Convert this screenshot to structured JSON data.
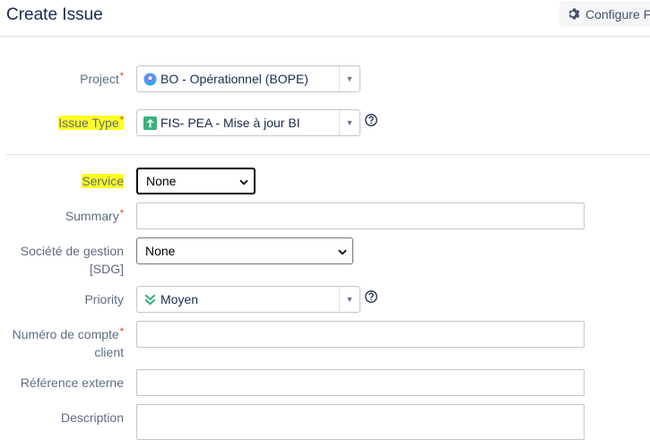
{
  "header": {
    "title": "Create Issue",
    "configure_label": "Configure F",
    "gear_icon": "gear-icon"
  },
  "fields": {
    "project": {
      "label": "Project",
      "required": "*",
      "value": "BO - Opérationnel (BOPE)",
      "icon": "project-avatar-icon"
    },
    "issue_type": {
      "label": "Issue Type",
      "required": "*",
      "value": "FIS- PEA - Mise à jour BI",
      "icon": "arrow-up-icon",
      "highlighted": true
    },
    "service": {
      "label": "Service",
      "value": "None",
      "highlighted": true
    },
    "summary": {
      "label": "Summary",
      "required": "*",
      "value": ""
    },
    "societe": {
      "label_line1": "Société de gestion",
      "label_line2": "[SDG]",
      "value": "None"
    },
    "priority": {
      "label": "Priority",
      "value": "Moyen",
      "icon": "priority-double-chevron-down-icon"
    },
    "numero": {
      "label_line1": "Numéro de compte",
      "label_line2": "client",
      "required": "*",
      "value": ""
    },
    "reference": {
      "label": "Référence externe",
      "value": ""
    },
    "description": {
      "label": "Description",
      "value": ""
    }
  },
  "colors": {
    "highlight": "#ffff1f",
    "required": "#de350b",
    "issue_type_icon": "#36b37e",
    "priority_icon": "#36b37e"
  }
}
